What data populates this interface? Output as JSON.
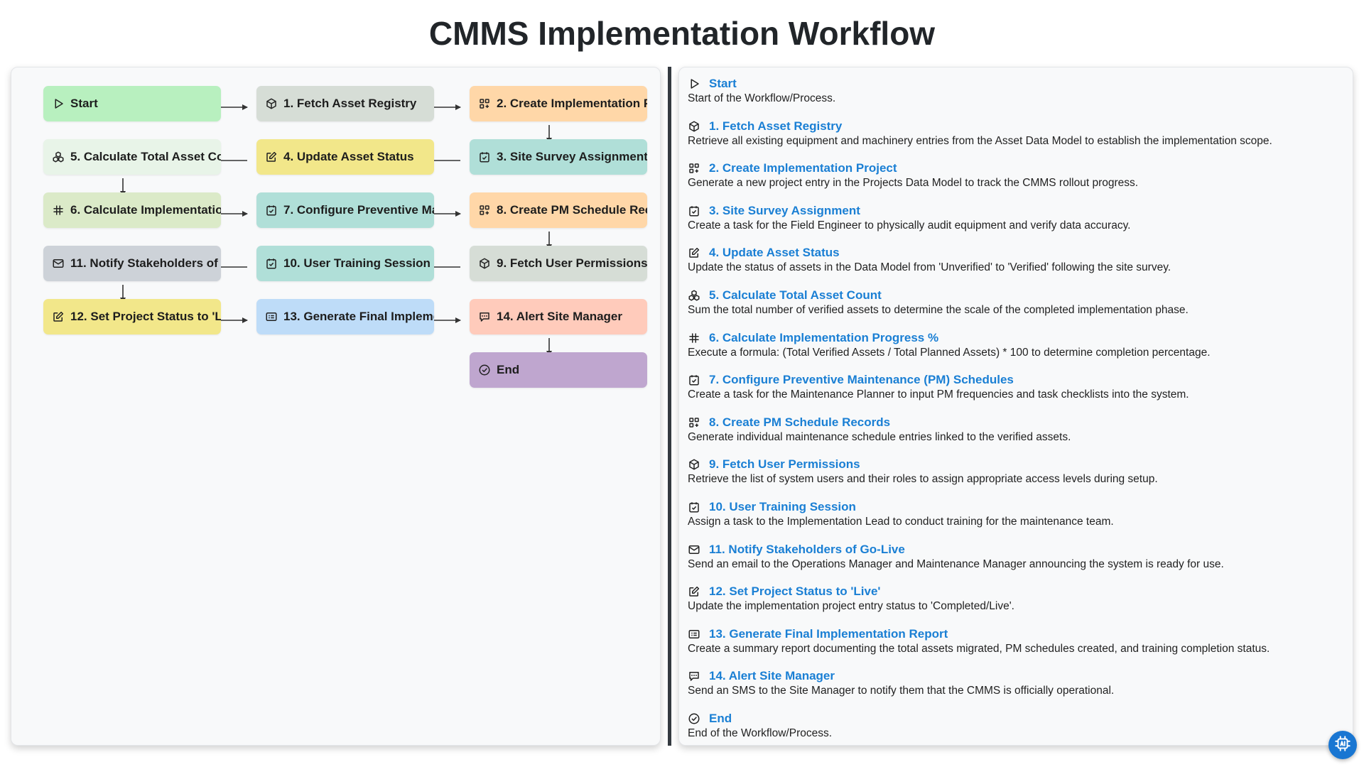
{
  "title": "CMMS Implementation Workflow",
  "nodes": [
    {
      "id": "start",
      "label": "Start",
      "icon": "play-icon",
      "color": "green"
    },
    {
      "id": "n1",
      "label": "1. Fetch Asset Registry",
      "icon": "cube-icon",
      "color": "gray"
    },
    {
      "id": "n2",
      "label": "2. Create Implementation Project",
      "icon": "grid-plus-icon",
      "color": "orange"
    },
    {
      "id": "n3",
      "label": "3. Site Survey Assignment",
      "icon": "task-check-icon",
      "color": "teal"
    },
    {
      "id": "n4",
      "label": "4. Update Asset Status",
      "icon": "edit-icon",
      "color": "yellow"
    },
    {
      "id": "n5",
      "label": "5. Calculate Total Asset Count",
      "icon": "cubes-icon",
      "color": "mint"
    },
    {
      "id": "n6",
      "label": "6. Calculate Implementation Progress %",
      "icon": "hash-icon",
      "color": "lime"
    },
    {
      "id": "n7",
      "label": "7. Configure Preventive Maintenance (PM) Schedules",
      "icon": "task-check-icon",
      "color": "teal"
    },
    {
      "id": "n8",
      "label": "8. Create PM Schedule Records",
      "icon": "grid-plus-icon",
      "color": "orange"
    },
    {
      "id": "n9",
      "label": "9. Fetch User Permissions",
      "icon": "cube-icon",
      "color": "gray"
    },
    {
      "id": "n10",
      "label": "10. User Training Session",
      "icon": "task-check-icon",
      "color": "teal"
    },
    {
      "id": "n11",
      "label": "11. Notify Stakeholders of Go-Live",
      "icon": "mail-icon",
      "color": "slate"
    },
    {
      "id": "n12",
      "label": "12. Set Project Status to 'Live'",
      "icon": "edit-icon",
      "color": "yellow"
    },
    {
      "id": "n13",
      "label": "13. Generate Final Implementation Report",
      "icon": "report-icon",
      "color": "blue"
    },
    {
      "id": "n14",
      "label": "14. Alert Site Manager",
      "icon": "sms-icon",
      "color": "salmon"
    },
    {
      "id": "end",
      "label": "End",
      "icon": "check-circle-icon",
      "color": "purple"
    }
  ],
  "details": [
    {
      "title": "Start",
      "icon": "play-icon",
      "desc": "Start of the Workflow/Process."
    },
    {
      "title": "1. Fetch Asset Registry",
      "icon": "cube-icon",
      "desc": "Retrieve all existing equipment and machinery entries from the Asset Data Model to establish the implementation scope."
    },
    {
      "title": "2. Create Implementation Project",
      "icon": "grid-plus-icon",
      "desc": "Generate a new project entry in the Projects Data Model to track the CMMS rollout progress."
    },
    {
      "title": "3. Site Survey Assignment",
      "icon": "task-check-icon",
      "desc": "Create a task for the Field Engineer to physically audit equipment and verify data accuracy."
    },
    {
      "title": "4. Update Asset Status",
      "icon": "edit-icon",
      "desc": "Update the status of assets in the Data Model from 'Unverified' to 'Verified' following the site survey."
    },
    {
      "title": "5. Calculate Total Asset Count",
      "icon": "cubes-icon",
      "desc": "Sum the total number of verified assets to determine the scale of the completed implementation phase."
    },
    {
      "title": "6. Calculate Implementation Progress %",
      "icon": "hash-icon",
      "desc": "Execute a formula: (Total Verified Assets / Total Planned Assets) * 100 to determine completion percentage."
    },
    {
      "title": "7. Configure Preventive Maintenance (PM) Schedules",
      "icon": "task-check-icon",
      "desc": "Create a task for the Maintenance Planner to input PM frequencies and task checklists into the system."
    },
    {
      "title": "8. Create PM Schedule Records",
      "icon": "grid-plus-icon",
      "desc": "Generate individual maintenance schedule entries linked to the verified assets."
    },
    {
      "title": "9. Fetch User Permissions",
      "icon": "cube-icon",
      "desc": "Retrieve the list of system users and their roles to assign appropriate access levels during setup."
    },
    {
      "title": "10. User Training Session",
      "icon": "task-check-icon",
      "desc": "Assign a task to the Implementation Lead to conduct training for the maintenance team."
    },
    {
      "title": "11. Notify Stakeholders of Go-Live",
      "icon": "mail-icon",
      "desc": "Send an email to the Operations Manager and Maintenance Manager announcing the system is ready for use."
    },
    {
      "title": "12. Set Project Status to 'Live'",
      "icon": "edit-icon",
      "desc": "Update the implementation project entry status to 'Completed/Live'."
    },
    {
      "title": "13. Generate Final Implementation Report",
      "icon": "report-icon",
      "desc": "Create a summary report documenting the total assets migrated, PM schedules created, and training completion status."
    },
    {
      "title": "14. Alert Site Manager",
      "icon": "sms-icon",
      "desc": "Send an SMS to the Site Manager to notify them that the CMMS is officially operational."
    },
    {
      "title": "End",
      "icon": "check-circle-icon",
      "desc": "End of the Workflow/Process."
    }
  ],
  "colors": {
    "accent": "#1a7fd4",
    "green": "#b8f0bf",
    "gray": "#d6ddd6",
    "orange": "#ffd7a8",
    "teal": "#b0dfd8",
    "yellow": "#f2e78a",
    "mint": "#e8f4e8",
    "lime": "#dbeac8",
    "slate": "#cdd2d8",
    "blue": "#bedcf8",
    "salmon": "#ffcbbb",
    "purple": "#bfa6cf"
  },
  "fab_icon": "ai-assistant-icon"
}
